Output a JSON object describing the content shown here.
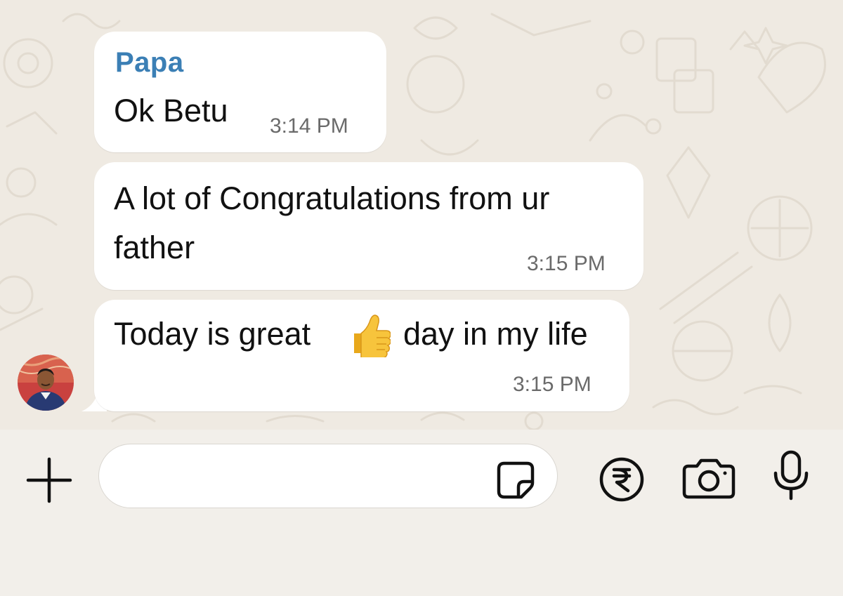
{
  "chat": {
    "messages": [
      {
        "sender": "Papa",
        "text": "Ok Betu",
        "time": "3:14 PM"
      },
      {
        "text_line1": "A lot of Congratulations from ur",
        "text_line2": "father",
        "time": "3:15 PM"
      },
      {
        "text_before_emoji": "Today is great",
        "emoji": "thumbs-up",
        "text_after_emoji": "day in my life",
        "time": "3:15 PM"
      }
    ]
  },
  "composer": {
    "input_value": "",
    "input_placeholder": ""
  },
  "icons": {
    "attach": "plus-icon",
    "sticker": "sticker-icon",
    "payment": "rupee-icon",
    "camera": "camera-icon",
    "voice": "microphone-icon"
  },
  "colors": {
    "sender_name": "#3b7fb5",
    "bubble": "#ffffff",
    "chat_background": "#efeae2",
    "composer_background": "#f2efea",
    "timestamp": "#6a6a6a"
  }
}
